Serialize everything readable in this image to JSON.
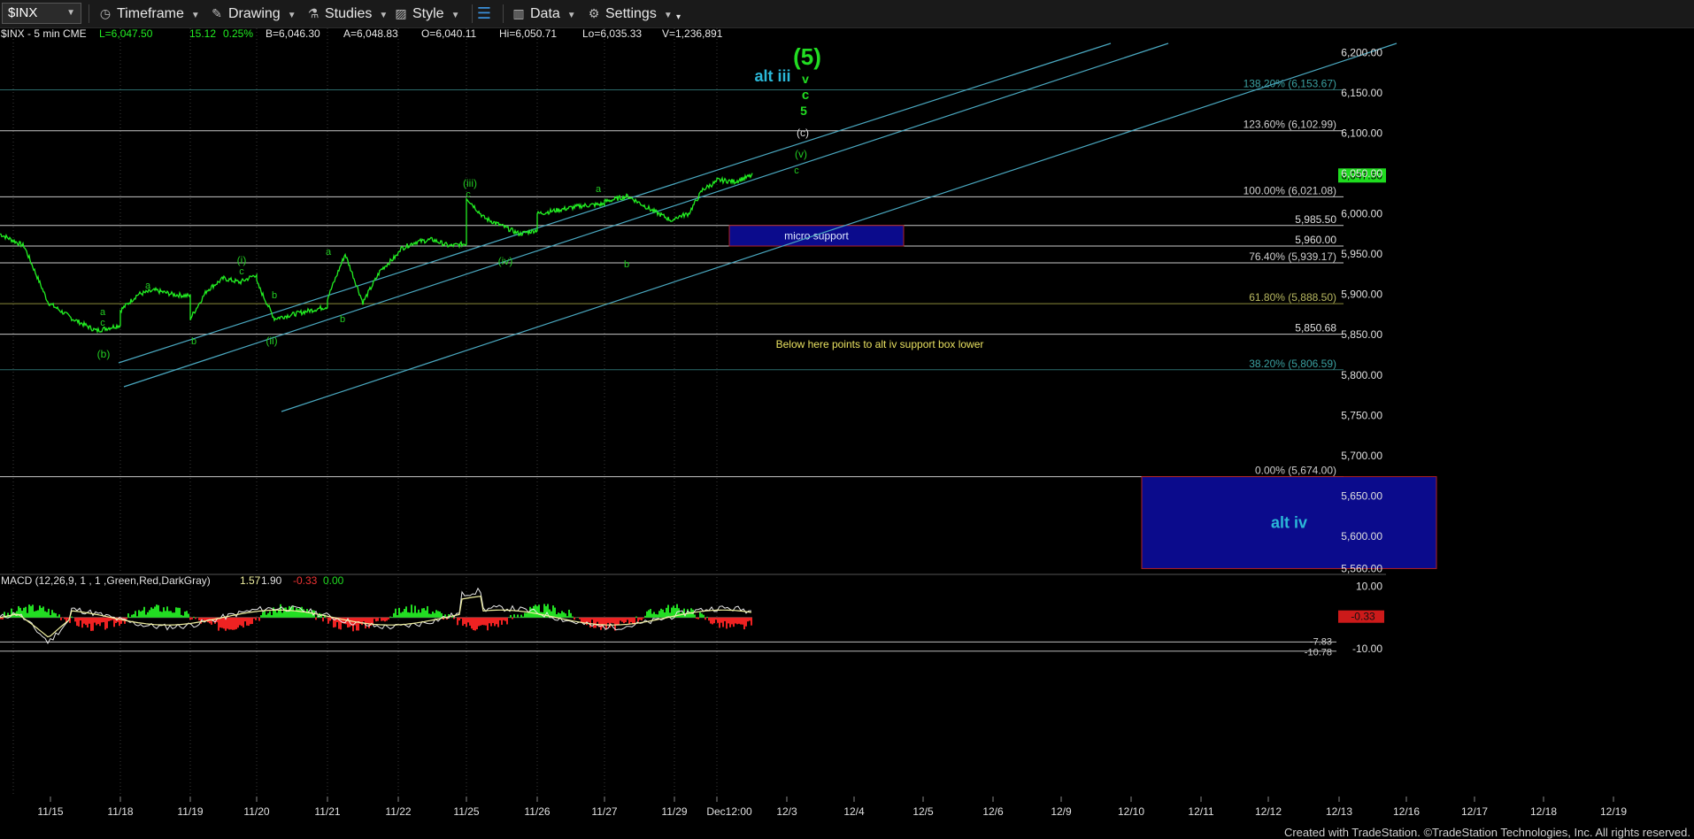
{
  "toolbar": {
    "symbol": "$INX",
    "timeframe_label": "Timeframe",
    "drawing_label": "Drawing",
    "studies_label": "Studies",
    "style_label": "Style",
    "data_label": "Data",
    "settings_label": "Settings"
  },
  "header": {
    "instrument": "$INX - 5 min  CME",
    "last": "L=6,047.50",
    "change": "15.12",
    "change_pct": "0.25%",
    "bid": "B=6,046.30",
    "ask": "A=6,048.83",
    "open": "O=6,040.11",
    "high": "Hi=6,050.71",
    "low": "Lo=6,035.33",
    "volume": "V=1,236,891"
  },
  "colors": {
    "background": "#000000",
    "price": "#22ee22",
    "wave_label": "#22cc22",
    "channel": "#4aa8c0",
    "level_line": "#c8c8c8",
    "fib_label": "#9a9a9a",
    "box_fill": "#0b0b8c",
    "box_border": "#b02020",
    "alt_label": "#2bb8d8",
    "annotation_yellow": "#e8e060",
    "macd_line": "#f0f0a0",
    "macd_pos": "#22dd22",
    "macd_neg": "#ee2222"
  },
  "chart_data": [
    {
      "type": "line",
      "title": "$INX - 5 min  CME",
      "x": [
        "11/15",
        "11/18",
        "11/19",
        "11/20",
        "11/21",
        "11/22",
        "11/25",
        "11/26",
        "11/27",
        "11/29",
        "Dec12:00",
        "12/3",
        "12/4",
        "12/5",
        "12/6",
        "12/9",
        "12/10",
        "12/11",
        "12/12",
        "12/13",
        "12/16",
        "12/17",
        "12/18",
        "12/19"
      ],
      "ylim": [
        5560,
        6230
      ],
      "y_ticks": [
        "6,200.00",
        "6,150.00",
        "6,100.00",
        "6,050.00",
        "6,000.00",
        "5,950.00",
        "5,900.00",
        "5,850.00",
        "5,800.00",
        "5,750.00",
        "5,700.00",
        "5,650.00",
        "5,600.00",
        "5,560.00"
      ],
      "y_tick_values": [
        6200,
        6150,
        6100,
        6050,
        6000,
        5950,
        5900,
        5850,
        5800,
        5750,
        5700,
        5650,
        5600,
        5560
      ],
      "series": [
        {
          "values_by_day": [
            [
              "11/15",
              5975,
              5960,
              5890,
              5870,
              5855,
              5862
            ],
            [
              "11/18",
              5880,
              5900,
              5905,
              5900,
              5898
            ],
            [
              "11/19",
              5870,
              5905,
              5920,
              5915,
              5925
            ],
            [
              "11/20",
              5915,
              5870,
              5875,
              5880,
              5885
            ],
            [
              "11/21",
              5895,
              5950,
              5890,
              5930,
              5950
            ],
            [
              "11/22",
              5955,
              5965,
              5968,
              5960,
              5963
            ],
            [
              "11/25",
              6020,
              5995,
              5985,
              5975,
              5980
            ],
            [
              "11/26",
              6000,
              6005,
              6010,
              6012
            ],
            [
              "11/27",
              6015,
              6022,
              6005,
              5990
            ],
            [
              "11/29",
              5995,
              6000,
              6030,
              6040
            ],
            [
              "Dec12:00",
              6042,
              6040,
              6047.5
            ]
          ]
        }
      ],
      "levels": [
        {
          "label": "138.20% (6,153.67)",
          "value": 6153.67,
          "kind": "fib"
        },
        {
          "label": "123.60% (6,102.99)",
          "value": 6102.99,
          "kind": "fib"
        },
        {
          "label": "100.00% (6,021.08)",
          "value": 6021.08,
          "kind": "fib"
        },
        {
          "label": "5,985.50",
          "value": 5985.5,
          "kind": "price"
        },
        {
          "label": "5,960.00",
          "value": 5960.0,
          "kind": "price"
        },
        {
          "label": "76.40% (5,939.17)",
          "value": 5939.17,
          "kind": "fib"
        },
        {
          "label": "61.80% (5,888.50)",
          "value": 5888.5,
          "kind": "fib"
        },
        {
          "label": "5,850.68",
          "value": 5850.68,
          "kind": "price"
        },
        {
          "label": "38.20% (5,806.59)",
          "value": 5806.59,
          "kind": "fib"
        },
        {
          "label": "0.00% (5,674.00)",
          "value": 5674.0,
          "kind": "fib"
        }
      ],
      "last_price_label": "6,047.50",
      "boxes": [
        {
          "label": "micro support",
          "x_from": "Dec12:00",
          "x_to": "12/5",
          "y_from": 5960,
          "y_to": 5985.5
        },
        {
          "label": "alt iv",
          "x_from": "12/10",
          "x_to": "12/17",
          "y_from": 5560,
          "y_to": 5674
        }
      ],
      "annotations": [
        "(5)",
        "alt iii",
        "v",
        "c",
        "5",
        "(c)",
        "(v)",
        "c",
        "(iii)",
        "c",
        "(iv)",
        "a",
        "b",
        "a",
        "b",
        "(i)",
        "c",
        "a",
        "b",
        "(ii)",
        "b",
        "a",
        "c",
        "(b)",
        "Below here points to alt iv support box lower"
      ]
    },
    {
      "type": "line",
      "title": "MACD (12,26,9, 1 , 1 ,Green,Red,DarkGray)",
      "legend_values": [
        "1.57",
        "1.90",
        "-0.33",
        "0.00"
      ],
      "y_ticks": [
        "10.00",
        "-10.00"
      ],
      "right_labels": [
        "-0.33",
        "-7.83",
        "-10.78"
      ],
      "ylim": [
        -12,
        13
      ],
      "levels": [
        -7.83,
        -10.78
      ]
    }
  ],
  "footer": "Created with TradeStation. ©TradeStation Technologies, Inc. All rights reserved."
}
